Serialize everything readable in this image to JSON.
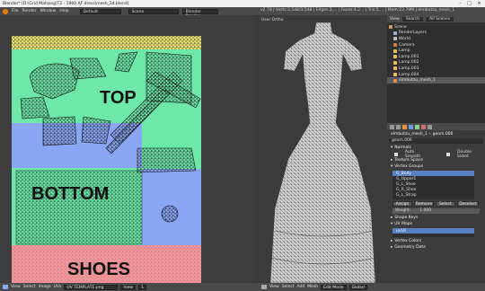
{
  "title": "Blender* [D:\\Grid Mahisng\\T2 - 1960 AF dress\\mesh_34.blend]",
  "window_controls": {
    "min": "–",
    "max": "□",
    "close": "✕"
  },
  "menu": [
    "File",
    "Render",
    "Window",
    "Help"
  ],
  "layout": "Default",
  "scene": "Scene",
  "engine": "Blender Render",
  "stats": "v2.78 | Verts:3,548/3,548 | Edges:2,... | Faces:4,2... | Tris:5,... | Mem:23.79M | elmbutzu_mesh_1",
  "uv": {
    "label_top": "TOP",
    "label_bottom": "BOTTOM",
    "label_shoes": "SHOES",
    "colors": {
      "green": "#6ee8a8",
      "blue": "#8aa6f5",
      "pink": "#f89aa0",
      "yellow": "#f4ee7a"
    }
  },
  "viewport": {
    "label": "User Ortho"
  },
  "outliner": {
    "header": {
      "view": "View",
      "search": "Search",
      "filter": "All Scenes"
    },
    "items": [
      {
        "label": "Scene",
        "color": "#d0a060"
      },
      {
        "label": "RenderLayers",
        "color": "#9ab0d0"
      },
      {
        "label": "World",
        "color": "#c0c0c0"
      },
      {
        "label": "Camera",
        "color": "#d08040"
      },
      {
        "label": "Lamp",
        "color": "#e8c060"
      },
      {
        "label": "Lamp.001",
        "color": "#e8c060"
      },
      {
        "label": "Lamp.002",
        "color": "#e8c060"
      },
      {
        "label": "Lamp.003",
        "color": "#e8c060"
      },
      {
        "label": "Lamp.004",
        "color": "#e8c060"
      },
      {
        "label": "elmbutzu_mesh_1",
        "color": "#e89040"
      }
    ]
  },
  "properties": {
    "object_name": "elmbutzu_mesh_1",
    "data_name": "geom.006",
    "mesh_name": "geom.006",
    "sections": {
      "normals": "Normals",
      "auto_smooth": "Auto Smooth",
      "double_sided": "Double Sided",
      "texture_space": "Texture Space",
      "vertex_groups": "Vertex Groups",
      "shape_keys": "Shape Keys",
      "uv_maps": "UV Maps",
      "vertex_colors": "Vertex Colors",
      "geometry_data": "Geometry Data"
    },
    "vertex_groups": [
      "G_Body",
      "G_Upper1",
      "G_L_Shoe",
      "G_R_Shoe",
      "G_L_Strap"
    ],
    "vg_buttons": [
      "Assign",
      "Remove",
      "Select",
      "Deselect"
    ],
    "weight_label": "Weight:",
    "weight_value": "1.000",
    "uv_map": "uvLR"
  },
  "footer_left": {
    "items": [
      "View",
      "Select",
      "Image",
      "UVs"
    ],
    "image_name": "UV TEMPLATE.png",
    "view_label": "View",
    "frame": "1"
  },
  "footer_right": {
    "items": [
      "View",
      "Select",
      "Add",
      "Mesh"
    ],
    "mode": "Edit Mode",
    "global": "Global"
  }
}
